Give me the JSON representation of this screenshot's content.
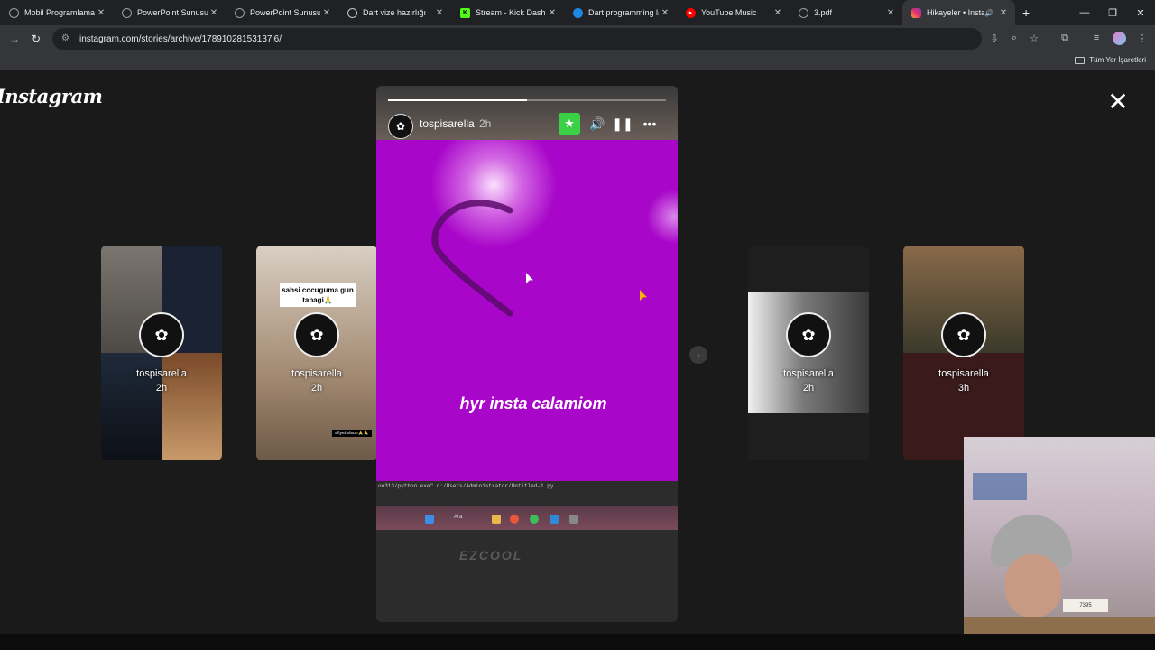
{
  "browser": {
    "tabs": [
      {
        "title": "Mobil Programlama",
        "favicon": "globe-icon",
        "color": "#9aa0a6"
      },
      {
        "title": "PowerPoint Sunusu",
        "favicon": "globe-icon",
        "color": "#9aa0a6"
      },
      {
        "title": "PowerPoint Sunusu",
        "favicon": "globe-icon",
        "color": "#9aa0a6"
      },
      {
        "title": "Dart vize hazırlığı",
        "favicon": "chatgpt-icon",
        "color": "#9aa0a6"
      },
      {
        "title": "Stream - Kick Dashbo",
        "favicon": "kick-icon",
        "color": "#53fc18"
      },
      {
        "title": "Dart programming la",
        "favicon": "dart-icon",
        "color": "#1e88e5"
      },
      {
        "title": "YouTube Music",
        "favicon": "youtube-music-icon",
        "color": "#ff0000"
      },
      {
        "title": "3.pdf",
        "favicon": "globe-icon",
        "color": "#9aa0a6"
      },
      {
        "title": "Hikayeler • Instag",
        "favicon": "instagram-icon",
        "color": "#e1306c",
        "active": true
      }
    ],
    "url": "instagram.com/stories/archive/17891028153137l6/",
    "bookmarks_all": "Tüm Yer İşaretleri"
  },
  "page": {
    "logo": "Instagram"
  },
  "story": {
    "username": "tospisarella",
    "time": "2h",
    "text": "hyr insta calamiom",
    "progress": 0.5,
    "terminal_text": "on313/python.exe\" c:/Users/Administrator/Untitled-1.py",
    "taskbar_search": "Ara",
    "brand": "EZCOOL"
  },
  "previews": [
    {
      "username": "tospisarella",
      "time": "2h"
    },
    {
      "username": "tospisarella",
      "time": "2h",
      "caption": "sahsi cocuguma gun tabagi🙏",
      "tag": "afiyet olsun🙏🙏"
    },
    {
      "username": "tospisarella",
      "time": "2h"
    },
    {
      "username": "tospisarella",
      "time": "3h"
    }
  ],
  "webcam": {
    "sign": "7395"
  }
}
